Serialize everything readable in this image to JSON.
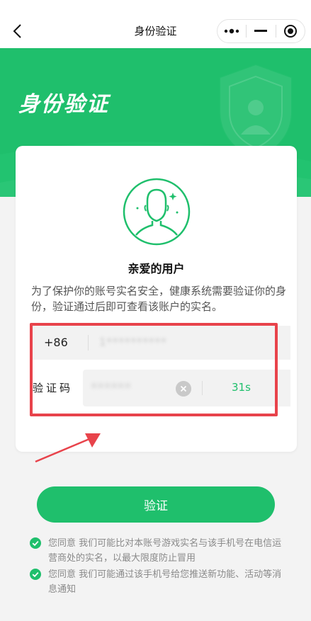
{
  "navbar": {
    "title": "身份验证",
    "back_icon": "chevron-left-icon",
    "more_icon": "more-dots-icon",
    "minimize_icon": "minimize-icon",
    "close_icon": "target-close-icon"
  },
  "hero": {
    "title": "身份验证",
    "color": "#1fbf6c"
  },
  "card": {
    "greeting": "亲爱的用户",
    "description": "为了保护你的账号实名安全，健康系统需要验证你的身份，验证通过后即可查看该账户的实名。",
    "phone": {
      "country_code": "+86",
      "value": "1**********"
    },
    "code": {
      "label": "验证码",
      "value": "******",
      "countdown": "31s"
    }
  },
  "verify_button": "验证",
  "agreements": [
    {
      "text": "您同意 我们可能比对本账号游戏实名与该手机号在电信运营商处的实名，以最大限度防止冒用",
      "checked": true
    },
    {
      "text": "您同意 我们可能通过该手机号给您推送新功能、活动等消息通知",
      "checked": true
    }
  ],
  "colors": {
    "accent": "#1fbf6c",
    "highlight": "#e8434b"
  }
}
